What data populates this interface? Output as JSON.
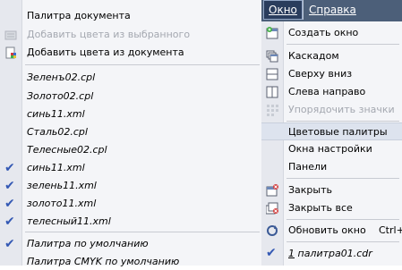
{
  "menubar": {
    "window_label": "Окно",
    "help_label": "Справка"
  },
  "palette_submenu": {
    "document_palette": "Палитра документа",
    "add_from_selected": "Добавить цвета из выбранного",
    "add_from_document": "Добавить цвета из документа",
    "palettes": [
      {
        "name": "Зеленъ02.cpl",
        "checked": false
      },
      {
        "name": "Золото02.cpl",
        "checked": false
      },
      {
        "name": "синь11.xml",
        "checked": false
      },
      {
        "name": "Сталь02.cpl",
        "checked": false
      },
      {
        "name": "Телесные02.cpl",
        "checked": false
      },
      {
        "name": "синь11.xml",
        "checked": true
      },
      {
        "name": "зелень11.xml",
        "checked": true
      },
      {
        "name": "золото11.xml",
        "checked": true
      },
      {
        "name": "телесный11.xml",
        "checked": true
      }
    ],
    "default_palette": "Палитра по умолчанию",
    "default_palette_checked": true,
    "default_cmyk_palette": "Палитра CMYK по умолчанию",
    "check_mark": "✔"
  },
  "window_menu": {
    "new_window": "Создать окно",
    "cascade": "Каскадом",
    "tile_vertical": "Сверху вниз",
    "tile_horizontal": "Слева направо",
    "arrange_icons": "Упорядочить значки",
    "color_palettes": "Цветовые палитры",
    "settings_windows": "Окна настройки",
    "panels": "Панели",
    "close": "Закрыть",
    "close_all": "Закрыть все",
    "refresh_window": "Обновить окно",
    "refresh_shortcut": "Ctrl+",
    "document_index": "1",
    "document_name": "палитра01.cdr"
  },
  "colors": {
    "menubar_bg": "#4c5f79",
    "active_menu_bg": "#2a3d5d",
    "check_color": "#3358b4",
    "highlight_bg": "#dde3ee"
  }
}
